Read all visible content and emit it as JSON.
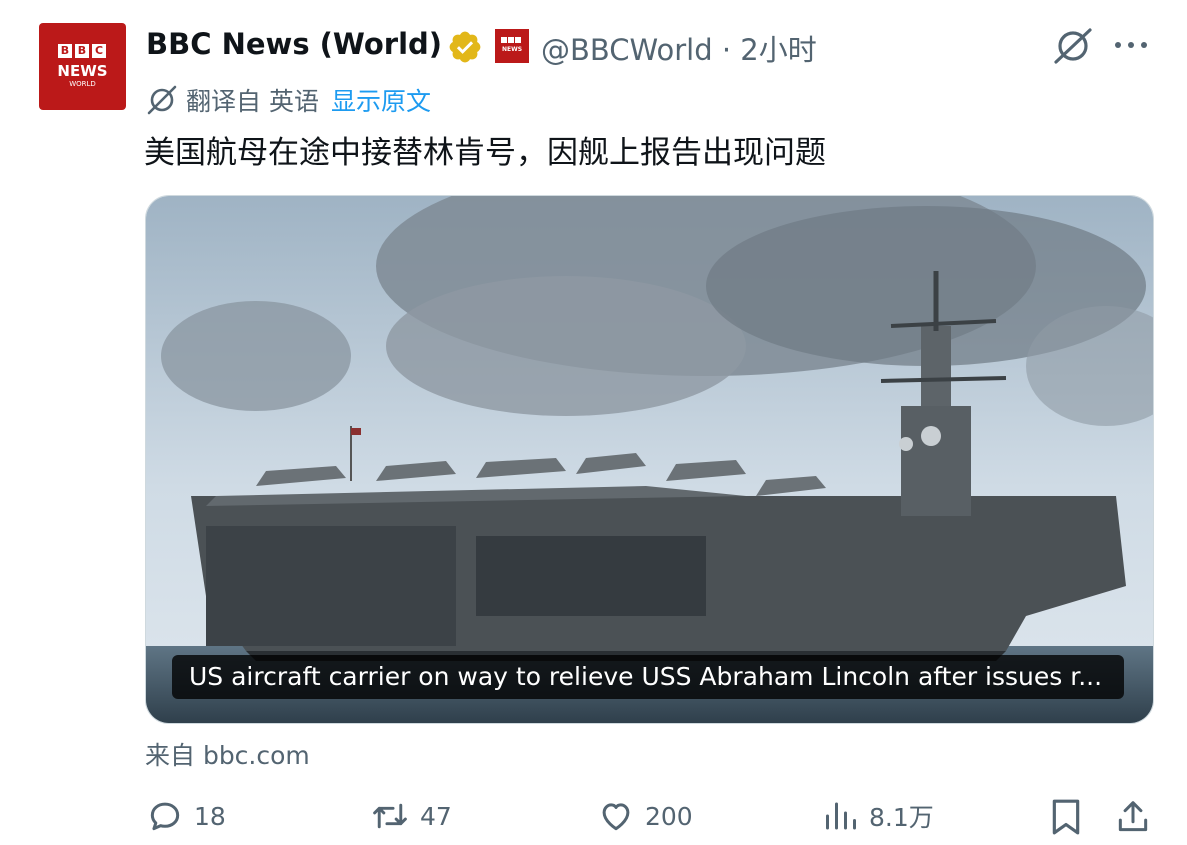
{
  "account": {
    "avatar_brand": [
      "B",
      "B",
      "C"
    ],
    "avatar_news": "NEWS",
    "avatar_world": "WORLD",
    "name": "BBC News (World)",
    "handle_time": "@BBCWorld · 2小时",
    "verified_color": "#e2b719",
    "affiliate_badge_text": "NEWS"
  },
  "translation": {
    "label": "翻译自 英语",
    "show_original": "显示原文"
  },
  "tweet": {
    "text": "美国航母在途中接替林肯号，因舰上报告出现问题"
  },
  "card": {
    "caption": "US aircraft carrier on way to relieve USS Abraham Lincoln after issues r..."
  },
  "source": {
    "from": "来自 bbc.com"
  },
  "actions": {
    "replies": "18",
    "reposts": "47",
    "likes": "200",
    "views": "8.1万"
  },
  "icons": {
    "grok": "grok-icon",
    "more": "more-icon",
    "translate": "translate-icon",
    "reply": "reply-icon",
    "repost": "repost-icon",
    "like": "like-icon",
    "views": "views-icon",
    "bookmark": "bookmark-icon",
    "share": "share-icon"
  },
  "colors": {
    "link": "#1d9bf0",
    "secondary_text": "#536471",
    "bbc_red": "#bb1919"
  }
}
